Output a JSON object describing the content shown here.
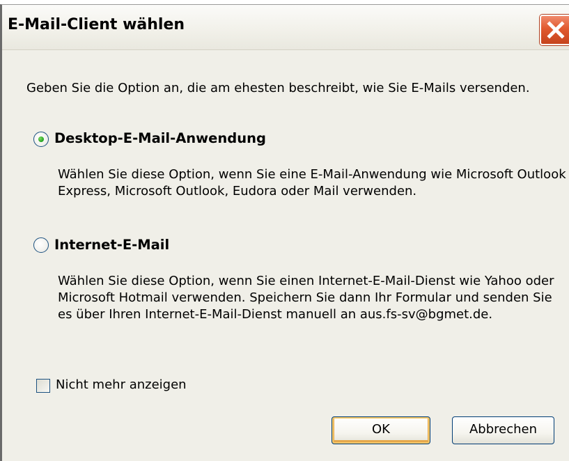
{
  "dialog": {
    "title": "E-Mail-Client wählen",
    "intro": "Geben Sie die Option an, die am ehesten beschreibt, wie Sie E-Mails versenden.",
    "options": [
      {
        "label": "Desktop-E-Mail-Anwendung",
        "selected": true,
        "description": "Wählen Sie diese Option, wenn Sie eine E-Mail-Anwendung wie Microsoft Outlook Express, Microsoft Outlook, Eudora oder Mail verwenden."
      },
      {
        "label": "Internet-E-Mail",
        "selected": false,
        "description": "Wählen Sie diese Option, wenn Sie einen Internet-E-Mail-Dienst wie Yahoo oder Microsoft Hotmail verwenden. Speichern Sie dann Ihr Formular und senden Sie es über Ihren Internet-E-Mail-Dienst manuell an aus.fs-sv@bgmet.de."
      }
    ],
    "checkbox": {
      "label": "Nicht mehr anzeigen",
      "checked": false
    },
    "buttons": {
      "ok": "OK",
      "cancel": "Abbrechen"
    },
    "icons": {
      "close": "close-icon"
    },
    "colors": {
      "close_button": "#e15a2f",
      "radio_selected_dot": "#21a121",
      "control_border": "#1c5180",
      "background": "#f0efe8"
    }
  }
}
